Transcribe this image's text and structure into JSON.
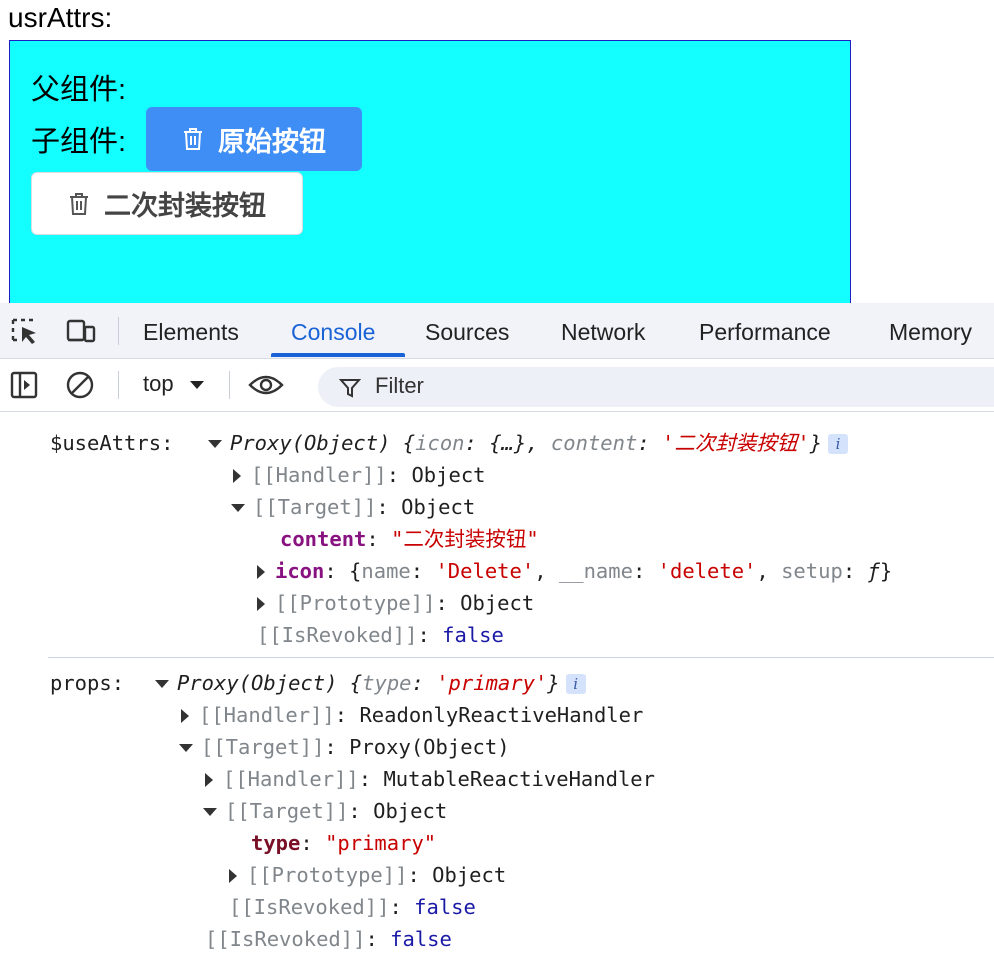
{
  "page": {
    "title": "usrAttrs:",
    "parent_label": "父组件:",
    "child_label": "子组件:",
    "primary_button": "原始按钮",
    "wrapped_button": "二次封装按钮"
  },
  "devtools": {
    "tabs": [
      "Elements",
      "Console",
      "Sources",
      "Network",
      "Performance",
      "Memory"
    ],
    "active_tab": "Console",
    "context": "top",
    "filter_placeholder": "Filter"
  },
  "console": {
    "entry1": {
      "label": "$useAttrs:",
      "proxy": "Proxy(Object)",
      "preview_key1": "icon",
      "preview_val1": "{…}",
      "preview_key2": "content",
      "preview_val2": "'二次封装按钮'",
      "handler": "[[Handler]]",
      "handler_val": "Object",
      "target": "[[Target]]",
      "target_val": "Object",
      "content_key": "content",
      "content_val": "\"二次封装按钮\"",
      "icon_key": "icon",
      "icon_name_key": "name",
      "icon_name_val": "'Delete'",
      "icon_uname_key": "__name",
      "icon_uname_val": "'delete'",
      "icon_setup_key": "setup",
      "icon_setup_val": "ƒ",
      "prototype": "[[Prototype]]",
      "prototype_val": "Object",
      "revoked": "[[IsRevoked]]",
      "revoked_val": "false"
    },
    "entry2": {
      "label": "props:",
      "proxy": "Proxy(Object)",
      "preview_key": "type",
      "preview_val": "'primary'",
      "handler": "[[Handler]]",
      "handler_val": "ReadonlyReactiveHandler",
      "target": "[[Target]]",
      "target_val": "Proxy(Object)",
      "inner_handler": "[[Handler]]",
      "inner_handler_val": "MutableReactiveHandler",
      "inner_target": "[[Target]]",
      "inner_target_val": "Object",
      "type_key": "type",
      "type_val": "\"primary\"",
      "prototype": "[[Prototype]]",
      "prototype_val": "Object",
      "inner_revoked": "[[IsRevoked]]",
      "inner_revoked_val": "false",
      "revoked": "[[IsRevoked]]",
      "revoked_val": "false"
    }
  }
}
